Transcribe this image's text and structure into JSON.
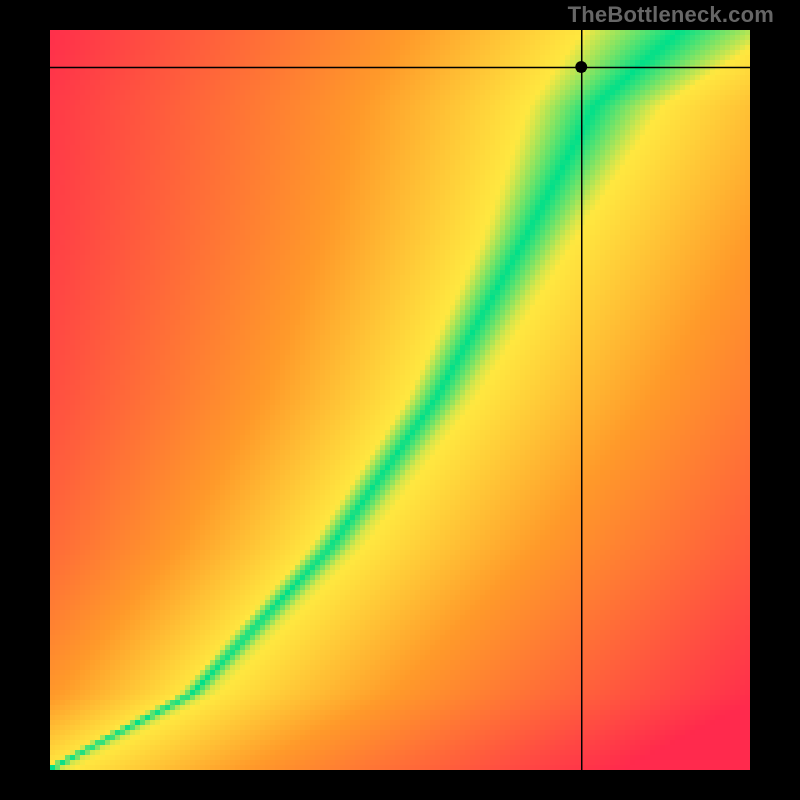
{
  "attribution": "TheBottleneck.com",
  "colors": {
    "background": "#000000",
    "red": "#ff2a4d",
    "orange": "#ff9a2a",
    "yellow": "#ffe840",
    "green": "#00e08a",
    "crosshair": "#000000",
    "marker": "#000000"
  },
  "chart_data": {
    "type": "heatmap",
    "title": "",
    "xlabel": "",
    "ylabel": "",
    "xlim": [
      0,
      1
    ],
    "ylim": [
      0,
      1
    ],
    "crosshair": {
      "x": 0.76,
      "y": 0.95
    },
    "marker": {
      "x": 0.76,
      "y": 0.95,
      "r": 6
    },
    "optimal_band": {
      "description": "Green optimal curve with yellow falloff; outside fades to orange then red. Curve is roughly y ≈ x^1.5 from origin, then straightens toward upper middle and fans out near the top.",
      "anchors": [
        {
          "x": 0.0,
          "y": 0.0,
          "half_width": 0.015
        },
        {
          "x": 0.2,
          "y": 0.1,
          "half_width": 0.02
        },
        {
          "x": 0.4,
          "y": 0.3,
          "half_width": 0.03
        },
        {
          "x": 0.55,
          "y": 0.5,
          "half_width": 0.04
        },
        {
          "x": 0.68,
          "y": 0.72,
          "half_width": 0.055
        },
        {
          "x": 0.78,
          "y": 0.9,
          "half_width": 0.08
        },
        {
          "x": 0.9,
          "y": 1.0,
          "half_width": 0.12
        }
      ]
    },
    "resolution": {
      "w": 140,
      "h": 148
    }
  }
}
